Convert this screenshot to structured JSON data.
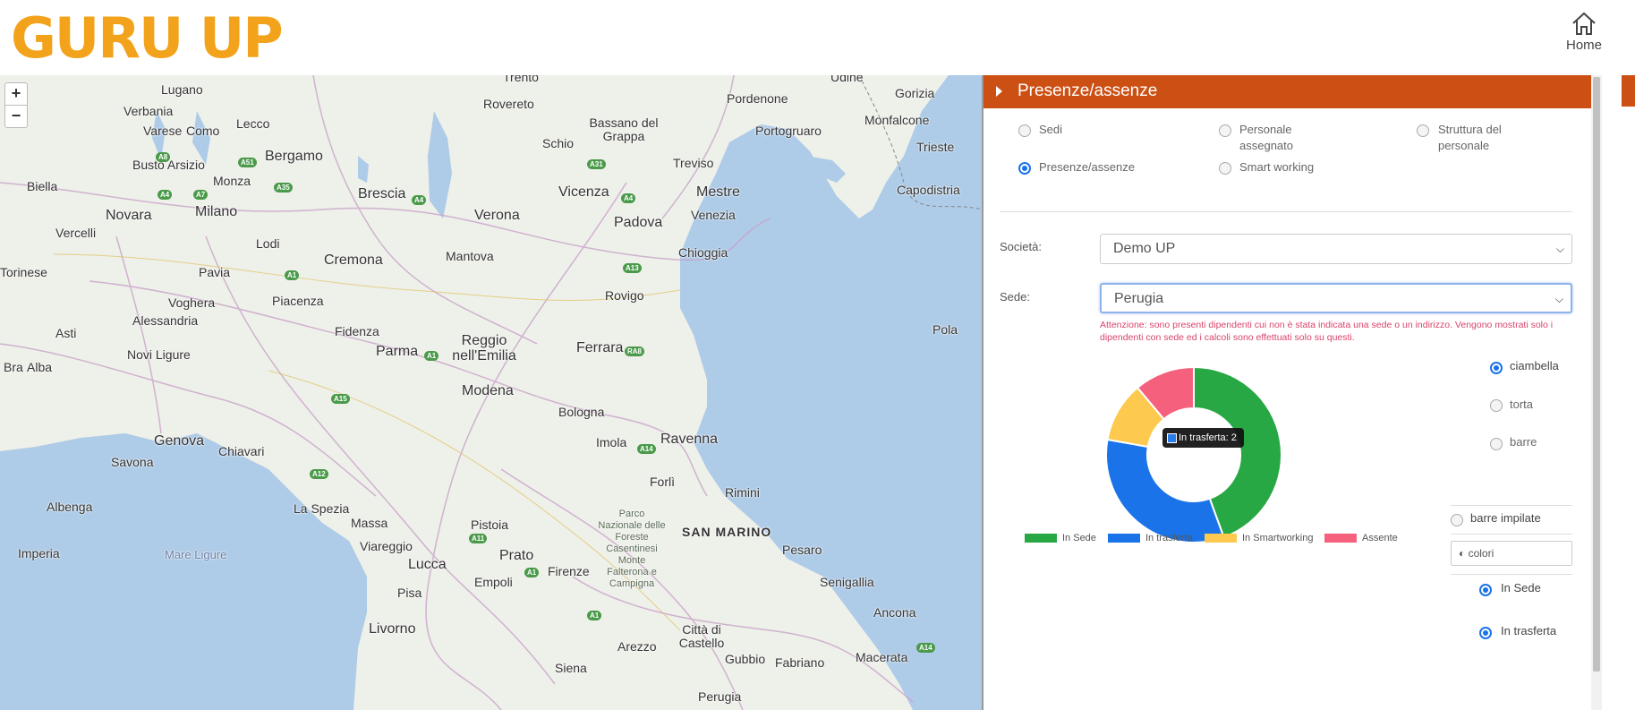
{
  "header": {
    "logo_text": "GURU UP",
    "home_label": "Home"
  },
  "map": {
    "zoom_in": "+",
    "zoom_out": "−",
    "labels": {
      "lugano": "Lugano",
      "rovereto": "Rovereto",
      "trento": "Trento",
      "pordenone": "Pordenone",
      "udine": "Udine",
      "gorizia": "Gorizia",
      "verbania": "Verbania",
      "varese": "Varese",
      "como": "Como",
      "lecco": "Lecco",
      "bassano": "Bassano del Grappa",
      "schio": "Schio",
      "portogruaro": "Portogruaro",
      "monfalcone": "Monfalcone",
      "trieste": "Trieste",
      "bergamo": "Bergamo",
      "busto": "Busto Arsizio",
      "treviso": "Treviso",
      "biella": "Biella",
      "monza": "Monza",
      "brescia": "Brescia",
      "vicenza": "Vicenza",
      "mestre": "Mestre",
      "capodistria": "Capodistria",
      "novara": "Novara",
      "milano": "Milano",
      "verona": "Verona",
      "padova": "Padova",
      "venezia": "Venezia",
      "vercelli": "Vercelli",
      "lodi": "Lodi",
      "cremona": "Cremona",
      "mantova": "Mantova",
      "chioggia": "Chioggia",
      "torinese": "Torinese",
      "pavia": "Pavia",
      "voghera": "Voghera",
      "piacenza": "Piacenza",
      "rovigo": "Rovigo",
      "alessandria": "Alessandria",
      "asti": "Asti",
      "fidenza": "Fidenza",
      "parma": "Parma",
      "reggio": "Reggio nell'Emilia",
      "ferrara": "Ferrara",
      "pola": "Pola",
      "bra": "Bra",
      "alba": "Alba",
      "novi": "Novi Ligure",
      "modena": "Modena",
      "bologna": "Bologna",
      "genova": "Genova",
      "chiavari": "Chiavari",
      "imola": "Imola",
      "ravenna": "Ravenna",
      "savona": "Savona",
      "forli": "Forlì",
      "rimini": "Rimini",
      "albenga": "Albenga",
      "laspezia": "La Spezia",
      "massa": "Massa",
      "pistoia": "Pistoia",
      "sanmarino": "SAN MARINO",
      "parco": "Parco Nazionale delle Foreste Casentinesi Monte Falterona e Campigna",
      "mareligure": "Mare Ligure",
      "imperia": "Imperia",
      "viareggio": "Viareggio",
      "lucca": "Lucca",
      "prato": "Prato",
      "pesaro": "Pesaro",
      "empoli": "Empoli",
      "firenze": "Firenze",
      "senigallia": "Senigallia",
      "pisa": "Pisa",
      "ancona": "Ancona",
      "livorno": "Livorno",
      "citta": "Città di Castello",
      "arezzo": "Arezzo",
      "gubbio": "Gubbio",
      "fabriano": "Fabriano",
      "macerata": "Macerata",
      "siena": "Siena",
      "perugia": "Perugia"
    }
  },
  "panel": {
    "title": "Presenze/assenze",
    "view_options": {
      "sedi": "Sedi",
      "personale": "Personale assegnato",
      "struttura": "Struttura del personale",
      "presenze": "Presenze/assenze",
      "smart": "Smart working",
      "selected": "Presenze/assenze"
    },
    "societa_label": "Società:",
    "societa_value": "Demo UP",
    "sede_label": "Sede:",
    "sede_value": "Perugia",
    "warning": "Attenzione: sono presenti dipendenti cui non è stata indicata una sede o un indirizzo. Vengono mostrati solo i dipendenti con sede ed i calcoli sono effettuati solo su questi.",
    "chart_types": {
      "ciambella": "ciambella",
      "torta": "torta",
      "barre": "barre",
      "barre_impilate": "barre impilate",
      "selected": "ciambella"
    },
    "colori_label": "colori",
    "color_options": {
      "in_sede": "In Sede",
      "in_trasferta": "In trasferta"
    },
    "tooltip": "In trasferta: 2"
  },
  "colors": {
    "brand": "#f2a31b",
    "header_bar": "#cc4f14",
    "in_sede": "#27a844",
    "in_trasferta": "#1a73e8",
    "in_smartworking": "#fdc94e",
    "assente": "#f5617d"
  },
  "chart_data": {
    "type": "pie",
    "variant": "doughnut",
    "categories": [
      "In Sede",
      "In trasferta",
      "In Smartworking",
      "Assente"
    ],
    "values": [
      4,
      3,
      1,
      1
    ],
    "legend_position": "bottom"
  }
}
